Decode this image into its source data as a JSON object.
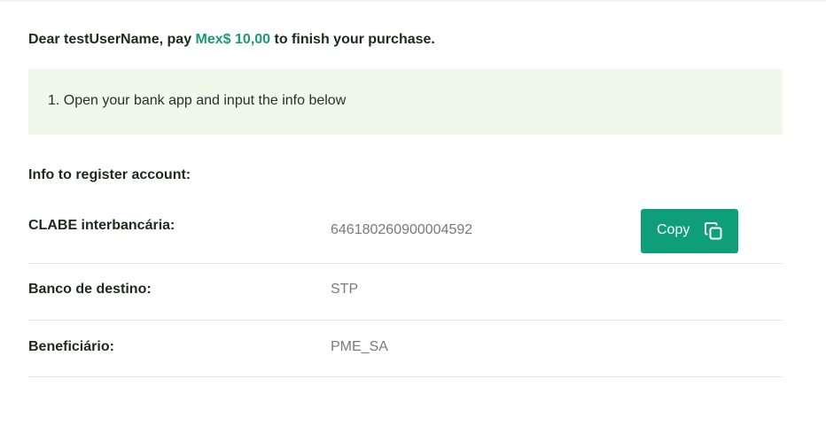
{
  "header": {
    "greeting_prefix": "Dear testUserName, pay ",
    "amount": "Mex$ 10,00",
    "greeting_suffix": " to finish your purchase."
  },
  "instructions": {
    "step_1": "1. Open your bank app and input the info below"
  },
  "account_info": {
    "title": "Info to register account:",
    "rows": [
      {
        "label": "CLABE interbancária:",
        "value": "646180260900004592"
      },
      {
        "label": "Banco de destino:",
        "value": "STP"
      },
      {
        "label": "Beneficiário:",
        "value": "PME_SA"
      }
    ],
    "copy_button_label": "Copy",
    "copy_icon": "copy-icon"
  },
  "colors": {
    "accent": "#1a9a72",
    "button": "#0f9e7a",
    "instruction_bg": "#eff9ea",
    "value_text": "#7a7a7a"
  }
}
